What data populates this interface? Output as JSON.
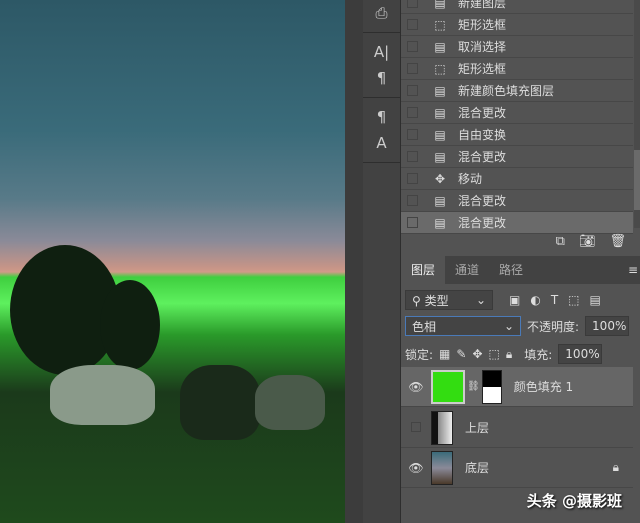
{
  "history": {
    "items": [
      {
        "label": "新建图层",
        "icon": "document-icon"
      },
      {
        "label": "矩形选框",
        "icon": "marquee-icon"
      },
      {
        "label": "取消选择",
        "icon": "document-icon"
      },
      {
        "label": "矩形选框",
        "icon": "marquee-icon"
      },
      {
        "label": "新建颜色填充图层",
        "icon": "document-icon"
      },
      {
        "label": "混合更改",
        "icon": "document-icon"
      },
      {
        "label": "自由变换",
        "icon": "document-icon"
      },
      {
        "label": "混合更改",
        "icon": "document-icon"
      },
      {
        "label": "移动",
        "icon": "move-icon"
      },
      {
        "label": "混合更改",
        "icon": "document-icon"
      },
      {
        "label": "混合更改",
        "icon": "document-icon",
        "selected": true
      }
    ]
  },
  "tools": {
    "char": "A|",
    "para": "¶",
    "pstyle": "¶",
    "cstyle": "A"
  },
  "layers": {
    "tabs": [
      "图层",
      "通道",
      "路径"
    ],
    "filter": "类型",
    "blend_mode": "色相",
    "opacity_label": "不透明度:",
    "opacity": "100%",
    "lock_label": "锁定:",
    "fill_label": "填充:",
    "fill": "100%",
    "items": [
      {
        "name": "颜色填充 1",
        "visible": true,
        "fill_color": "#33dd11",
        "selected": true
      },
      {
        "name": "上层",
        "visible": false
      },
      {
        "name": "底层",
        "visible": true,
        "locked": true
      }
    ]
  },
  "watermark": "头条 @摄影班"
}
